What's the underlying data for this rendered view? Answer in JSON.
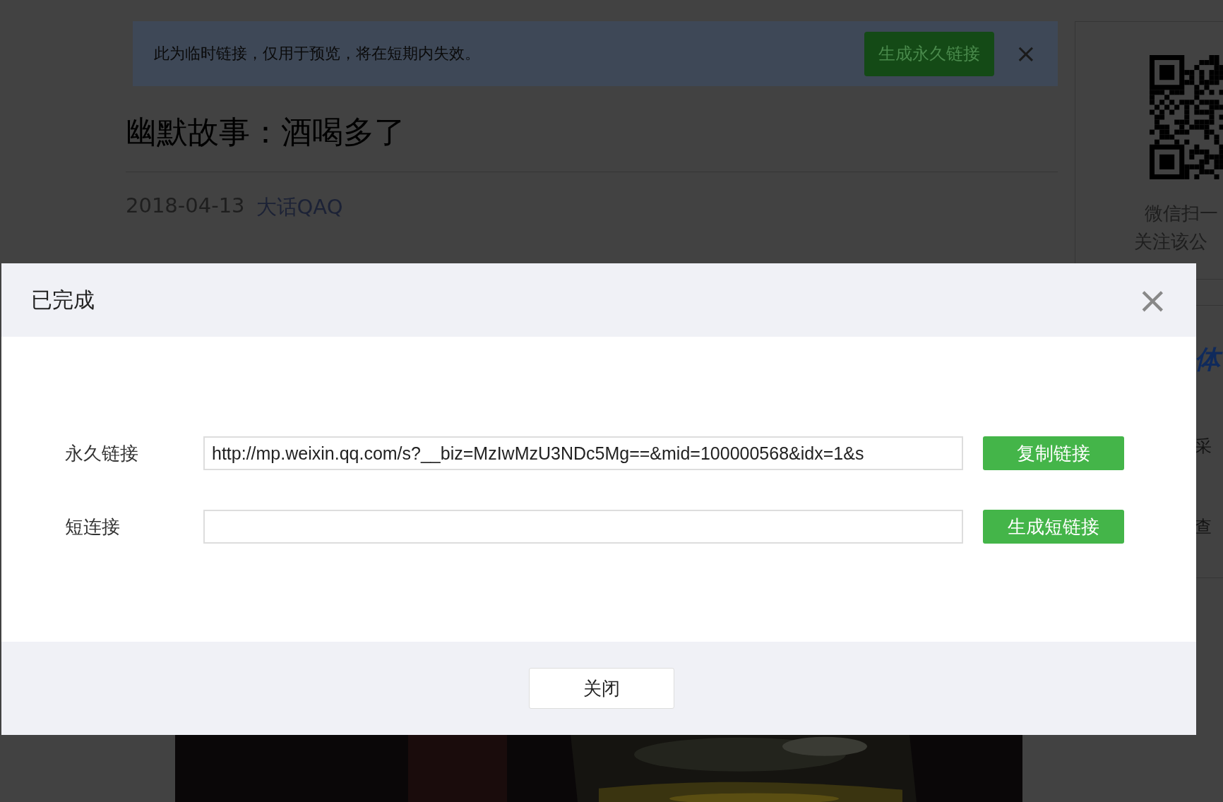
{
  "page": {
    "notice": {
      "text": "此为临时链接，仅用于预览，将在短期内失效。",
      "button": "生成永久链接",
      "close": "×"
    },
    "article": {
      "title": "幽默故事：酒喝多了",
      "date": "2018-04-13",
      "author": "大话QAQ"
    },
    "sidebar": {
      "qr_caption": [
        "微信扫一",
        "关注该公"
      ],
      "items": [
        {
          "kind": "heading",
          "text": "体"
        },
        {
          "kind": "text",
          "text": "采"
        },
        {
          "kind": "text",
          "text": "查"
        }
      ]
    }
  },
  "dialog": {
    "title": "已完成",
    "close": "×",
    "fields": [
      {
        "label": "永久链接",
        "value": "http://mp.weixin.qq.com/s?__biz=MzIwMzU3NDc5Mg==&mid=100000568&idx=1&s",
        "button": "复制链接"
      },
      {
        "label": "短连接",
        "button": "生成短链接"
      }
    ],
    "footer_button": "关闭"
  }
}
